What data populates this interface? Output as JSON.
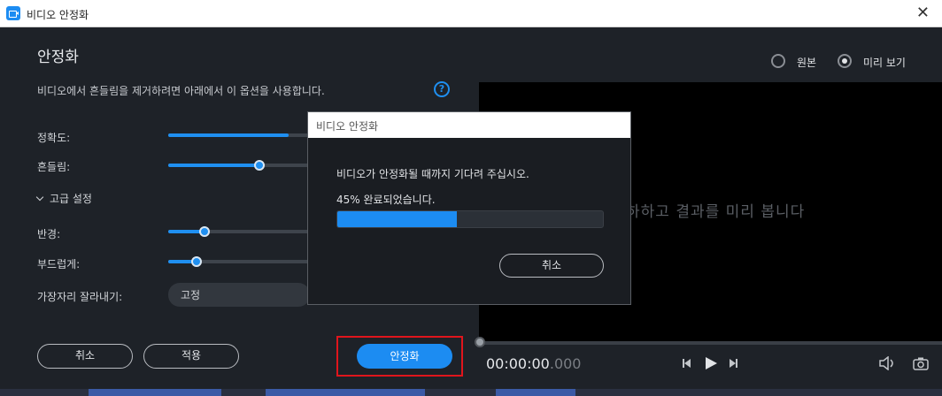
{
  "window": {
    "title": "비디오 안정화"
  },
  "panel": {
    "title": "안정화",
    "description": "비디오에서 흔들림을 제거하려면 아래에서 이 옵션을 사용합니다.",
    "accuracy_label": "정확도:",
    "accuracy_value": 0.85,
    "shake_label": "흔들림:",
    "shake_value": 0.55,
    "advanced_label": "고급 설정",
    "radius_label": "반경:",
    "radius_value": 0.25,
    "smooth_label": "부드럽게:",
    "smooth_value": 0.2,
    "crop_label": "가장자리 잘라내기:",
    "crop_value": "고정",
    "cancel_label": "취소",
    "apply_label": "적용",
    "stabilize_label": "안정화"
  },
  "preview": {
    "original_label": "원본",
    "preview_label": "미리 보기",
    "selected": "preview",
    "hint_visible": "하하고 결과를 미리 봅니다",
    "timecode_main": "00:00:00",
    "timecode_ms": ".000"
  },
  "modal": {
    "title": "비디오 안정화",
    "message": "비디오가 안정화될 때까지 기다려 주십시오.",
    "percent_text": "45% 완료되었습니다.",
    "progress": 0.45,
    "cancel_label": "취소"
  },
  "colors": {
    "accent": "#1c8cf2",
    "highlight": "#e0151c"
  },
  "icons": [
    "video-camera-icon",
    "close-icon",
    "help-icon",
    "chevron-down-icon",
    "prev-frame-icon",
    "play-icon",
    "next-frame-icon",
    "volume-icon",
    "camera-icon"
  ]
}
